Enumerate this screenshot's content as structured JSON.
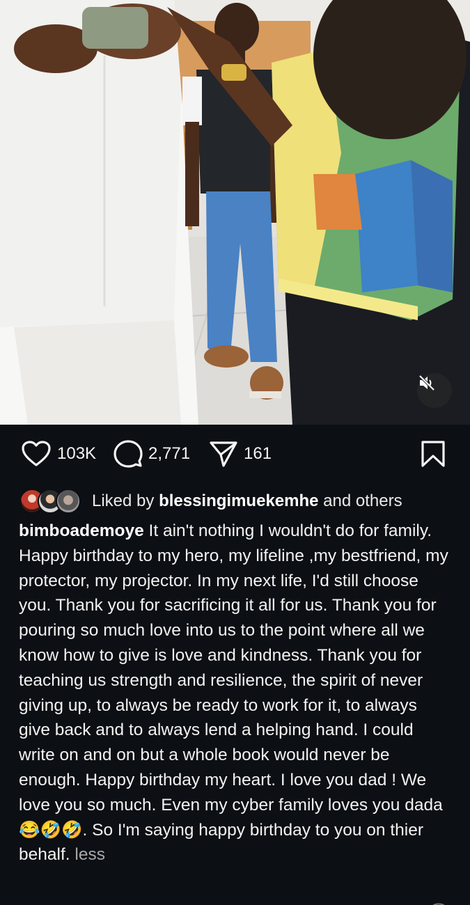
{
  "post": {
    "media": {
      "description_icon": "muted-speaker-icon"
    },
    "actions": {
      "likes_count": "103K",
      "comments_count": "2,771",
      "shares_count": "161",
      "like_icon": "heart-icon",
      "comment_icon": "comment-bubble-icon",
      "share_icon": "paper-plane-icon",
      "save_icon": "bookmark-icon"
    },
    "liked_by": {
      "prefix": "Liked by ",
      "username": "blessingimuekemhe",
      "suffix": " and others"
    },
    "caption": {
      "username": "bimboademoye",
      "text": " It ain't nothing I wouldn't do for family. Happy birthday to my hero, my lifeline ,my bestfriend, my protector, my projector. In my next life, I'd still choose you. Thank you for sacrificing it all for us. Thank you for pouring so much love into us to the point where all we know how to give is love and kindness. Thank you for teaching us strength and resilience, the spirit of never giving up, to always be ready to work for it, to always give back and to always lend a helping hand. I could write on and on but a whole book would never be enough.  Happy birthday my heart. I love you dad ! We love you so much. Even my cyber family loves you dada 😂🤣🤣. So I'm saying happy birthday to you on thier behalf.",
      "less_label": "less"
    }
  },
  "colors": {
    "background": "#0c0f14",
    "text": "#f2f2f2",
    "muted": "#a8a8a8"
  }
}
